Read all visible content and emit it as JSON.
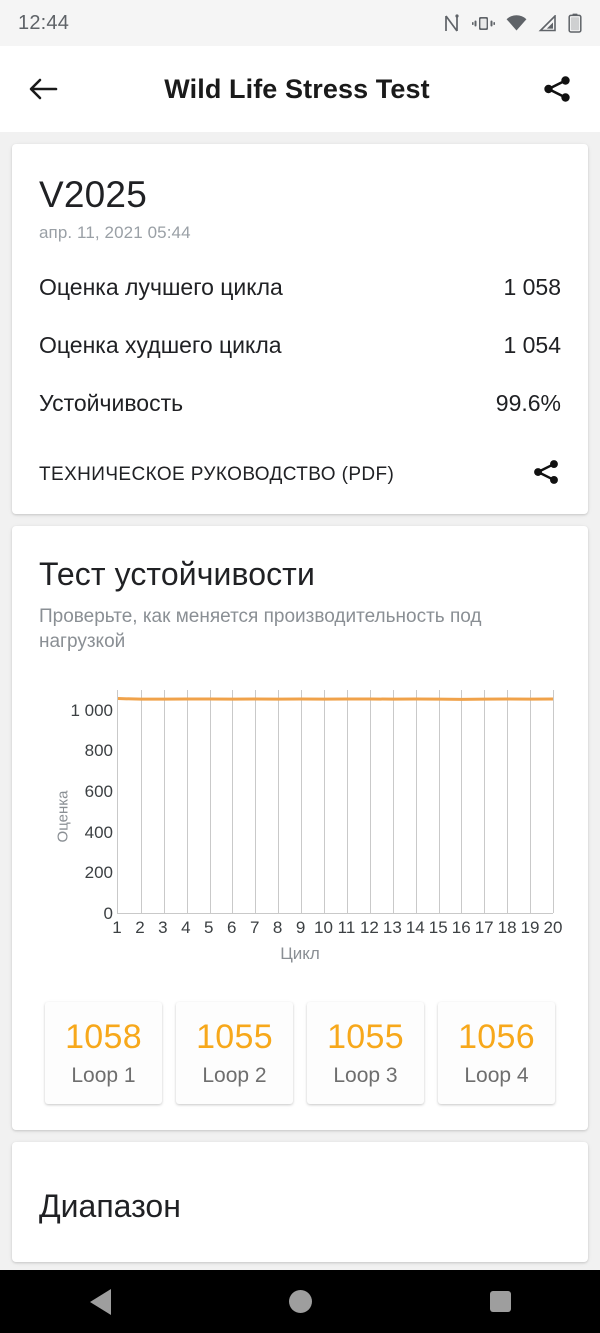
{
  "status_bar": {
    "time": "12:44",
    "icons": [
      "nfc-icon",
      "vibrate-icon",
      "wifi-icon",
      "signal-icon",
      "battery-icon"
    ]
  },
  "app_bar": {
    "back_label": "back-arrow",
    "title": "Wild Life Stress Test",
    "share_label": "share"
  },
  "summary_card": {
    "version": "V2025",
    "date": "апр. 11, 2021 05:44",
    "rows": [
      {
        "label": "Оценка лучшего цикла",
        "value": "1 058"
      },
      {
        "label": "Оценка худшего цикла",
        "value": "1 054"
      },
      {
        "label": "Устойчивость",
        "value": "99.6%"
      }
    ],
    "pdf_label": "ТЕХНИЧЕСКОЕ РУКОВОДСТВО (PDF)"
  },
  "stress_card": {
    "title": "Тест устойчивости",
    "subtitle": "Проверьте, как меняется производительность под нагрузкой",
    "loops": [
      {
        "score": "1058",
        "label": "Loop 1"
      },
      {
        "score": "1055",
        "label": "Loop 2"
      },
      {
        "score": "1055",
        "label": "Loop 3"
      },
      {
        "score": "1056",
        "label": "Loop 4"
      }
    ]
  },
  "bottom_card": {
    "title": "Диапазон"
  },
  "nav_bar": {
    "back": "back-button",
    "home": "home-button",
    "recents": "recents-button"
  },
  "colors": {
    "accent_orange": "#f7a81b",
    "line_orange": "#f0a24a",
    "page_background": "#f1f1f1",
    "card_background": "#ffffff",
    "text_primary": "#202124",
    "text_secondary": "#8a8f94"
  },
  "chart_data": {
    "type": "line",
    "title": "",
    "xlabel": "Цикл",
    "ylabel": "Оценка",
    "x": [
      1,
      2,
      3,
      4,
      5,
      6,
      7,
      8,
      9,
      10,
      11,
      12,
      13,
      14,
      15,
      16,
      17,
      18,
      19,
      20
    ],
    "xticklabels": [
      "1",
      "2",
      "3",
      "4",
      "5",
      "6",
      "7",
      "8",
      "9",
      "10",
      "11",
      "12",
      "13",
      "14",
      "15",
      "16",
      "17",
      "18",
      "19",
      "20"
    ],
    "yticklabels": [
      "0",
      "200",
      "400",
      "600",
      "800",
      "1 000"
    ],
    "yticks": [
      0,
      200,
      400,
      600,
      800,
      1000
    ],
    "ylim": [
      0,
      1100
    ],
    "xlim": [
      1,
      20
    ],
    "grid": "vertical",
    "legend": "none",
    "series": [
      {
        "name": "Оценка",
        "color": "#f0a24a",
        "values": [
          1058,
          1055,
          1055,
          1056,
          1056,
          1055,
          1056,
          1055,
          1056,
          1055,
          1056,
          1056,
          1055,
          1056,
          1055,
          1054,
          1055,
          1056,
          1055,
          1056
        ]
      }
    ]
  }
}
